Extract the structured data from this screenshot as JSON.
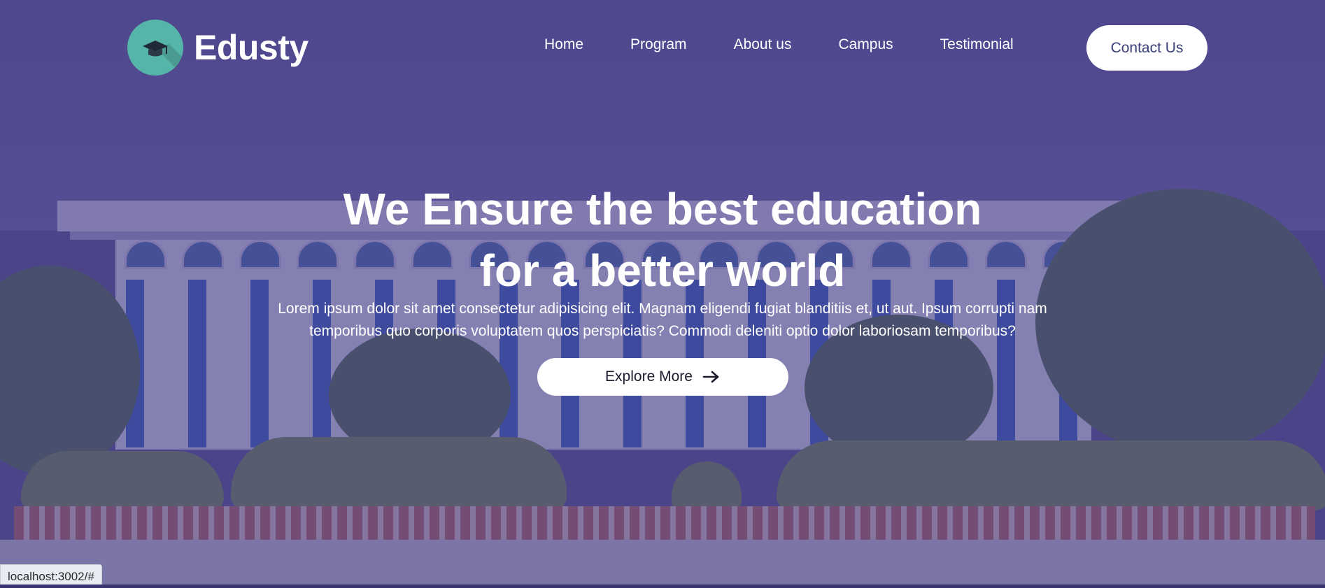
{
  "brand": {
    "name": "Edusty",
    "logo_icon": "graduation-cap-icon",
    "logo_color": "#56b5a9"
  },
  "nav": {
    "items": [
      "Home",
      "Program",
      "About us",
      "Campus",
      "Testimonial"
    ],
    "contact_label": "Contact Us"
  },
  "hero": {
    "headline_line1": "We Ensure the best education",
    "headline_line2": "for a better world",
    "description": "Lorem ipsum dolor sit amet consectetur adipisicing elit. Magnam eligendi fugiat blanditiis et, ut aut. Ipsum corrupti nam temporibus quo corporis voluptatem quos perspiciatis? Commodi deleniti optio dolor laboriosam temporibus?",
    "cta_label": "Explore More",
    "cta_icon": "arrow-right-icon",
    "overlay_color": "#48408c"
  },
  "statusbar": {
    "url": "localhost:3002/#"
  }
}
